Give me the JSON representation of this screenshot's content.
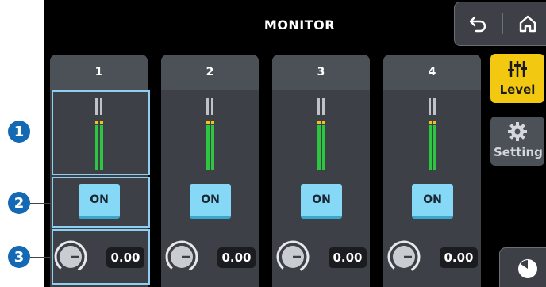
{
  "screen_title": "MONITOR",
  "nav": {
    "back_icon": "back-arrow-icon",
    "home_icon": "home-icon"
  },
  "channels": [
    {
      "label": "1",
      "on_label": "ON",
      "level_value": "0.00"
    },
    {
      "label": "2",
      "on_label": "ON",
      "level_value": "0.00"
    },
    {
      "label": "3",
      "on_label": "ON",
      "level_value": "0.00"
    },
    {
      "label": "4",
      "on_label": "ON",
      "level_value": "0.00"
    }
  ],
  "side_tabs": [
    {
      "label": "Level",
      "icon": "faders-icon",
      "active": true
    },
    {
      "label": "Setting",
      "icon": "gear-icon",
      "active": false
    }
  ],
  "callouts": [
    "1",
    "2",
    "3"
  ],
  "colors": {
    "background": "#000000",
    "panel": "#3d4147",
    "on_button": "#85d9f7",
    "active_tab": "#f2c811",
    "meter_green": "#2cc640",
    "callout": "#1469b4"
  }
}
